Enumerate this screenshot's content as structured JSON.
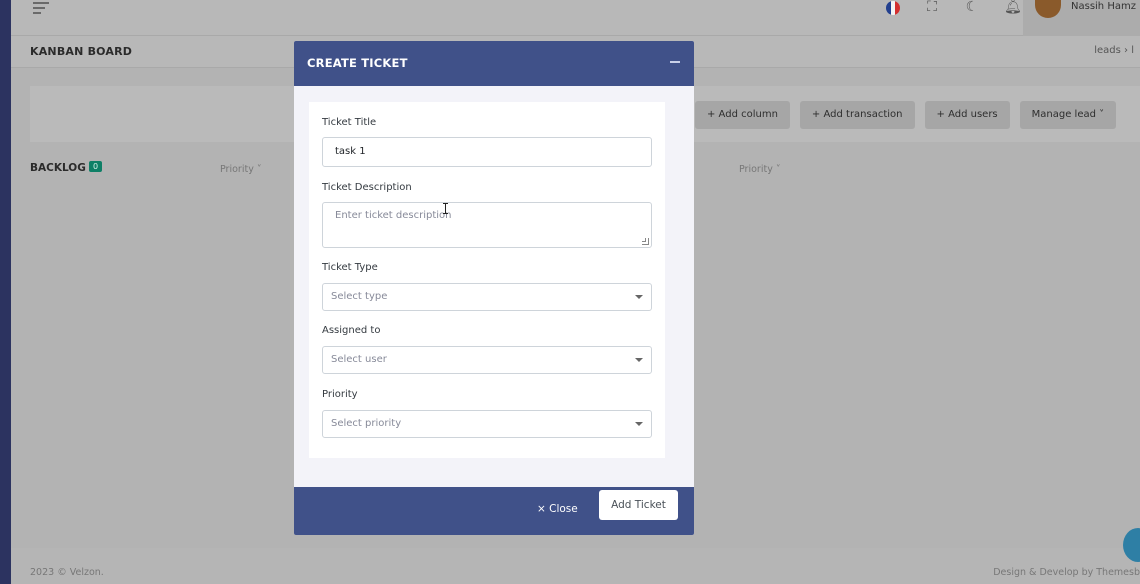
{
  "topbar": {
    "user_name": "Nassih Hamz",
    "icons": [
      "hamburger-icon",
      "flag-fr-icon",
      "fullscreen-icon",
      "moon-icon",
      "bell-icon"
    ]
  },
  "page": {
    "title": "KANBAN BOARD",
    "breadcrumb": "leads  ›  l"
  },
  "toolbar": {
    "buttons": [
      "+ Add column",
      "+ Add transaction",
      "+ Add users",
      "Manage lead ˅"
    ]
  },
  "board": {
    "column_name": "BACKLOG",
    "column_count": "0",
    "priority_label_1": "Priority ˅",
    "priority_label_2": "Priority ˅"
  },
  "footer": {
    "copyright": "2023 © Velzon.",
    "credit": "Design & Develop by Themesb"
  },
  "modal": {
    "title": "CREATE TICKET",
    "fields": {
      "title_label": "Ticket Title",
      "title_value": "task 1",
      "description_label": "Ticket Description",
      "description_placeholder": "Enter ticket description",
      "type_label": "Ticket Type",
      "type_placeholder": "Select type",
      "assigned_label": "Assigned to",
      "assigned_placeholder": "Select user",
      "priority_label": "Priority",
      "priority_placeholder": "Select priority"
    },
    "close_label": "× Close",
    "submit_label": "Add Ticket"
  },
  "colors": {
    "modal_header": "#405189",
    "badge": "#0e7f66",
    "overlay": "#b3b3b3"
  }
}
